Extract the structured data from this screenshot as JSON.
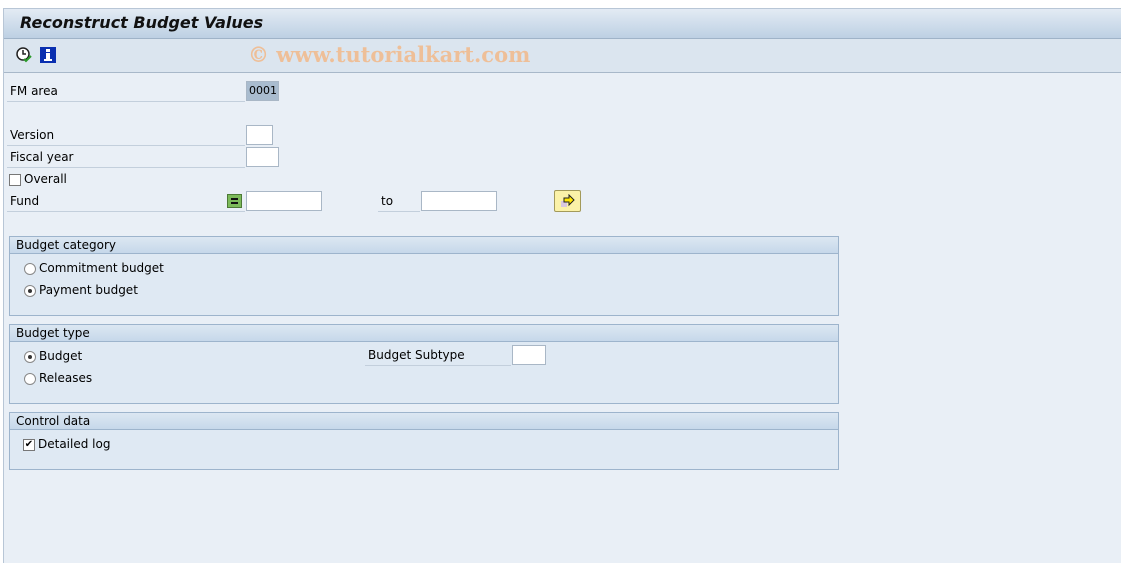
{
  "title": "Reconstruct Budget Values",
  "watermark": "© www.tutorialkart.com",
  "toolbar": {
    "execute_icon": "clock-check-icon",
    "info_icon": "info-icon"
  },
  "fields": {
    "fm_area": {
      "label": "FM area",
      "value": "0001"
    },
    "version": {
      "label": "Version",
      "value": ""
    },
    "fiscal_year": {
      "label": "Fiscal year",
      "value": ""
    },
    "overall": {
      "label": "Overall",
      "checked": false
    },
    "fund": {
      "label": "Fund",
      "from": "",
      "to_label": "to",
      "to": ""
    }
  },
  "budget_category": {
    "title": "Budget category",
    "options": [
      {
        "label": "Commitment budget",
        "selected": false
      },
      {
        "label": "Payment budget",
        "selected": true
      }
    ]
  },
  "budget_type": {
    "title": "Budget type",
    "options": [
      {
        "label": "Budget",
        "selected": true
      },
      {
        "label": "Releases",
        "selected": false
      }
    ],
    "subtype_label": "Budget Subtype",
    "subtype_value": ""
  },
  "control_data": {
    "title": "Control data",
    "detailed_log": {
      "label": "Detailed log",
      "checked": true
    }
  }
}
